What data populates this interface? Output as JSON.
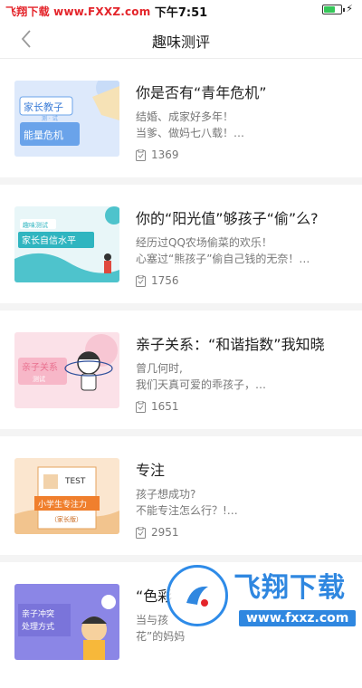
{
  "status_bar": {
    "watermark": "飞翔下载 www.FXXZ.com",
    "time": "下午7:51"
  },
  "nav": {
    "title": "趣味测评"
  },
  "items": [
    {
      "title": "你是否有“青年危机”",
      "desc_lines": [
        "结婚、成家好多年！",
        "当爹、做妈七八载！…"
      ],
      "count": "1369",
      "thumb_text": [
        "家长教子",
        "测 · 试",
        "能量危机"
      ]
    },
    {
      "title": "你的“阳光值”够孩子“偷”么?",
      "desc_lines": [
        "经历过QQ农场偷菜的欢乐！",
        "心塞过“熊孩子”偷自己钱的无奈！…"
      ],
      "count": "1756",
      "thumb_text": [
        "趣味测试",
        "家长自信水平"
      ]
    },
    {
      "title": "亲子关系：“和谐指数”我知晓",
      "desc_lines": [
        "曾几何时,",
        "我们天真可爱的乖孩子，…"
      ],
      "count": "1651",
      "thumb_text": [
        "亲子关系",
        "测试"
      ]
    },
    {
      "title": "专注",
      "desc_lines": [
        "孩子想成功?",
        "不能专注怎么行？!…"
      ],
      "count": "2951",
      "thumb_text": [
        "TEST",
        "小学生专注力",
        "（家长版）"
      ]
    },
    {
      "title": "“色彩",
      "desc_lines": [
        "当与孩",
        "花”的妈妈"
      ],
      "count": "",
      "thumb_text": [
        "亲子冲突",
        "处理方式"
      ]
    }
  ],
  "watermark_bottom": {
    "title": "飞翔下载",
    "url": "www.fxxz.com"
  },
  "colors": {
    "accent_blue": "#2f87e0",
    "watermark_red": "#e4252b"
  }
}
